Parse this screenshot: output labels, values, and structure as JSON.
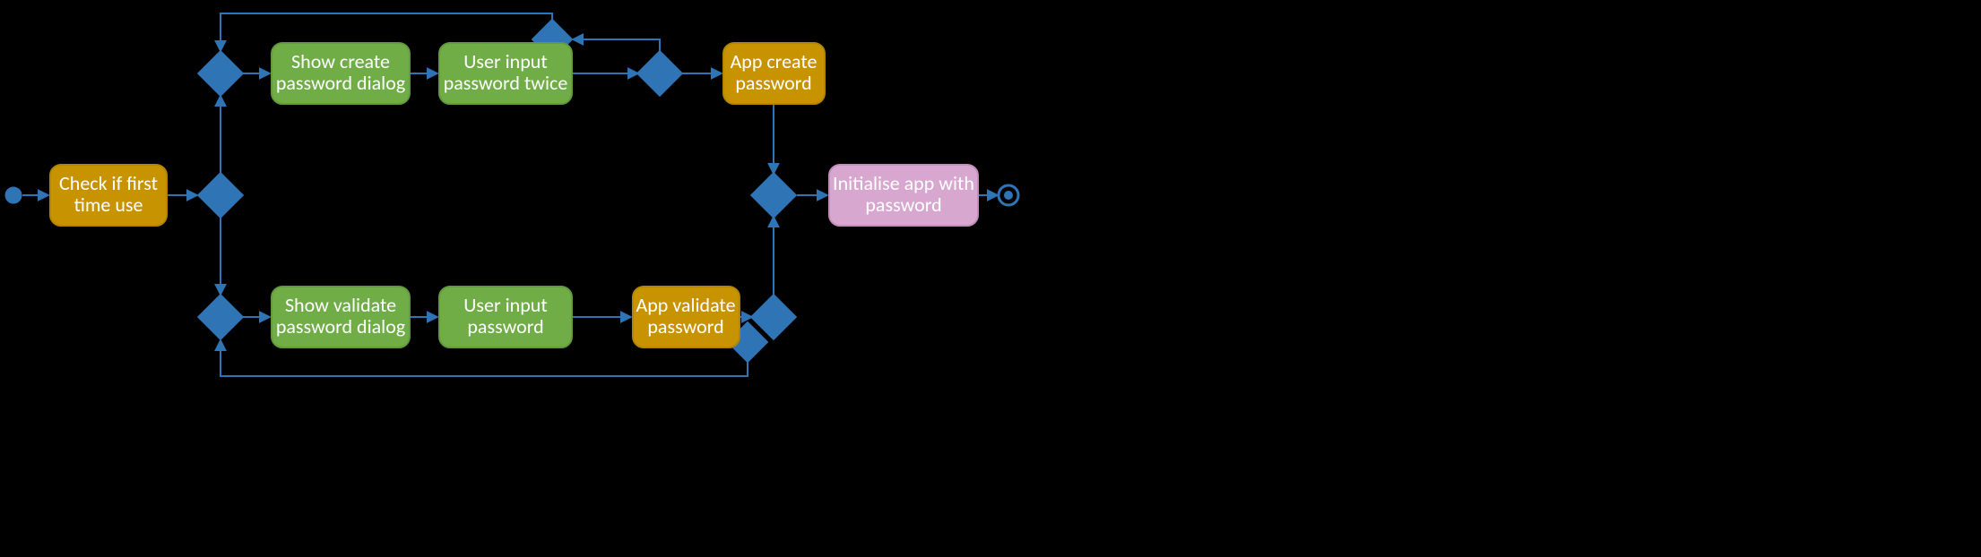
{
  "colors": {
    "gold": "#C79400",
    "green": "#70AD47",
    "pink": "#D8A7D0",
    "blue": "#2F74B5"
  },
  "nodes": {
    "checkFirst": {
      "line1": "Check if first",
      "line2": "time use"
    },
    "showCreate": {
      "line1": "Show create",
      "line2": "password dialog"
    },
    "inputTwice": {
      "line1": "User input",
      "line2": "password twice"
    },
    "appCreate": {
      "line1": "App create",
      "line2": "password"
    },
    "showValidate": {
      "line1": "Show validate",
      "line2": "password dialog"
    },
    "inputOnce": {
      "line1": "User input",
      "line2": "password"
    },
    "appValidate": {
      "line1": "App validate",
      "line2": "password"
    },
    "initApp": {
      "line1": "Initialise app with",
      "line2": "password"
    }
  }
}
